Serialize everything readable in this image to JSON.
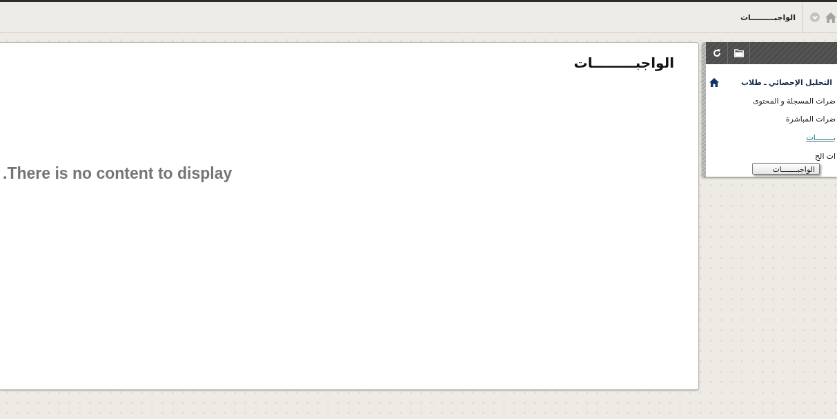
{
  "breadcrumb": {
    "items": [
      {
        "label": "الواجبـــــــــات"
      }
    ]
  },
  "content": {
    "title": "الواجبـــــــــات",
    "message": ".There is no content to display"
  },
  "course_menu": {
    "items": [
      {
        "label": "التحليل الإحصائي ـ طلاب",
        "kind": "course",
        "hovered": false
      },
      {
        "label": "ضرات المسجلة و المحتوى",
        "kind": "link",
        "hovered": false
      },
      {
        "label": "ضرات المباشرة",
        "kind": "link",
        "hovered": false
      },
      {
        "label": "بــــــــات",
        "kind": "link",
        "hovered": true
      },
      {
        "label": "ات الح",
        "kind": "link",
        "hovered": false
      }
    ],
    "tooltip": "الواجبـــــــات"
  }
}
